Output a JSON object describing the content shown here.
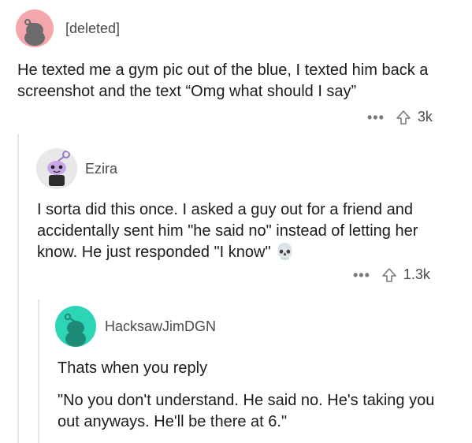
{
  "comments": [
    {
      "username": "[deleted]",
      "text": "He texted me a gym pic out of the blue, I texted him back a screenshot and the text “Omg what should I say”",
      "score": "3k"
    },
    {
      "username": "Ezira",
      "text": "I sorta did this once. I asked a guy out for a friend and accidentally sent him \"he said no\" instead of letting her know. He just responded \"I know\"",
      "emoji": "💀",
      "score": "1.3k"
    },
    {
      "username": "HacksawJimDGN",
      "text_line1": "Thats when you reply",
      "text_line2": "\"No you don't understand.  He said no. He's taking you out anyways. He'll be there at 6.\""
    }
  ],
  "actions": {
    "more_label": "•••"
  },
  "colors": {
    "deleted_avatar_bg": "#f4a6ad",
    "ezira_avatar_bg": "#e8e8e8",
    "hacksaw_avatar_bg": "#2dd4b6"
  }
}
